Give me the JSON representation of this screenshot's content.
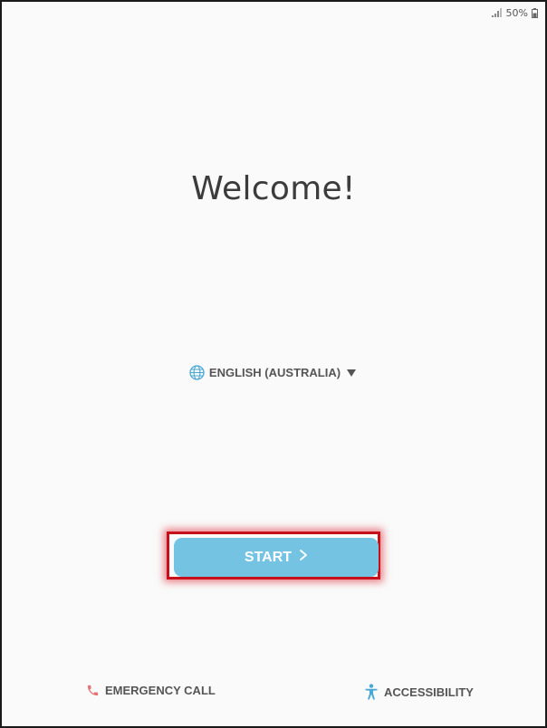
{
  "status_bar": {
    "battery_text": "50%"
  },
  "welcome": {
    "title": "Welcome!"
  },
  "language": {
    "selected": "ENGLISH (AUSTRALIA)"
  },
  "actions": {
    "start_label": "START",
    "emergency_label": "EMERGENCY CALL",
    "accessibility_label": "ACCESSIBILITY"
  },
  "colors": {
    "start_button": "#74c3e3",
    "highlight_border": "#c8101a",
    "emergency_icon": "#e57373",
    "accessibility_icon": "#4aa8d4",
    "globe_icon": "#4aa8d4"
  },
  "icons": {
    "signal": "signal-icon",
    "battery": "battery-icon",
    "globe": "globe-icon",
    "dropdown": "dropdown-arrow-icon",
    "chevron": "chevron-right-icon",
    "phone": "phone-icon",
    "accessibility": "accessibility-icon"
  }
}
